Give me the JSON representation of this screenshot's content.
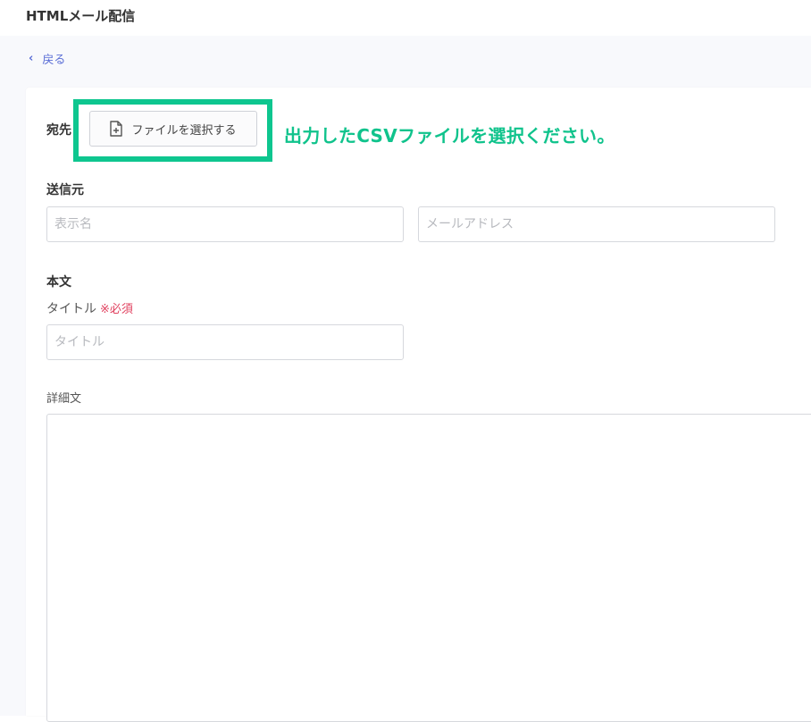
{
  "header": {
    "title": "HTMLメール配信"
  },
  "nav": {
    "back_label": "戻る"
  },
  "form": {
    "recipient_label": "宛先",
    "file_button_label": "ファイルを選択する",
    "annotation_text": "出力したCSVファイルを選択ください。",
    "sender_label": "送信元",
    "sender_name_placeholder": "表示名",
    "sender_email_placeholder": "メールアドレス",
    "body_label": "本文",
    "title_label": "タイトル",
    "required_mark": "※必須",
    "title_placeholder": "タイトル",
    "detail_label": "詳細文"
  },
  "colors": {
    "accent_link": "#5b6fd6",
    "annotation_green": "#10c38c",
    "required_red": "#e0405e"
  },
  "icons": {
    "back": "chevron-left-icon",
    "file": "file-plus-icon"
  }
}
